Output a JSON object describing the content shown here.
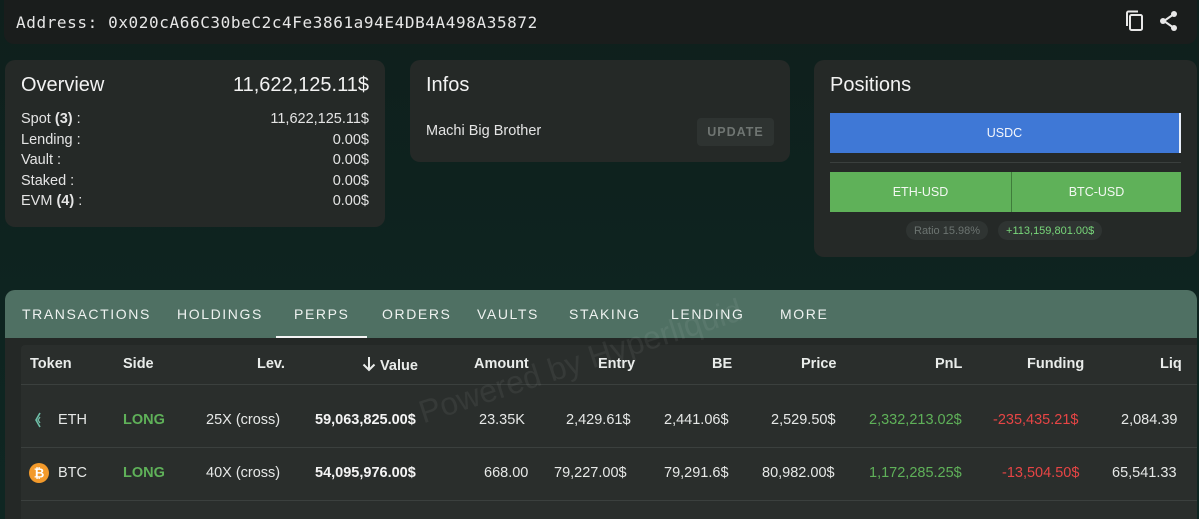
{
  "address": {
    "text": "Address: 0x020cA66C30beC2c4Fe3861a94E4DB4A498A35872",
    "icons": [
      "copy-icon",
      "share-icon"
    ]
  },
  "overview": {
    "title": "Overview",
    "total": "11,622,125.11$",
    "rows": [
      {
        "label": "Spot",
        "count": "(3)",
        "suffix": " :",
        "value": "11,622,125.11$"
      },
      {
        "label": "Lending :",
        "count": "",
        "suffix": "",
        "value": "0.00$"
      },
      {
        "label": "Vault :",
        "count": "",
        "suffix": "",
        "value": "0.00$"
      },
      {
        "label": "Staked :",
        "count": "",
        "suffix": "",
        "value": "0.00$"
      },
      {
        "label": "EVM",
        "count": "(4)",
        "suffix": " :",
        "value": "0.00$"
      }
    ]
  },
  "infos": {
    "title": "Infos",
    "name": "Machi Big Brother",
    "update_label": "UPDATE"
  },
  "positions": {
    "title": "Positions",
    "usdc_label": "USDC",
    "eth_label": "ETH-USD",
    "btc_label": "BTC-USD",
    "ratio": "Ratio 15.98%",
    "pnl": "+113,159,801.00$"
  },
  "tabs": [
    "TRANSACTIONS",
    "HOLDINGS",
    "PERPS",
    "ORDERS",
    "VAULTS",
    "STAKING",
    "LENDING",
    "MORE"
  ],
  "active_tab": "PERPS",
  "table": {
    "headers": {
      "token": "Token",
      "side": "Side",
      "lev": "Lev.",
      "value": "Value",
      "amount": "Amount",
      "entry": "Entry",
      "be": "BE",
      "price": "Price",
      "pnl": "PnL",
      "funding": "Funding",
      "liq": "Liq"
    },
    "rows": [
      {
        "token": "ETH",
        "side": "LONG",
        "lev": "25X (cross)",
        "value": "59,063,825.00$",
        "amount": "23.35K",
        "entry": "2,429.61$",
        "be": "2,441.06$",
        "price": "2,529.50$",
        "pnl": "2,332,213.02$",
        "funding": "-235,435.21$",
        "liq": "2,084.39"
      },
      {
        "token": "BTC",
        "side": "LONG",
        "lev": "40X (cross)",
        "value": "54,095,976.00$",
        "amount": "668.00",
        "entry": "79,227.00$",
        "be": "79,291.6$",
        "price": "80,982.00$",
        "pnl": "1,172,285.25$",
        "funding": "-13,504.50$",
        "liq": "65,541.33"
      }
    ]
  },
  "watermark": "Powered by Hyperliquid",
  "colors": {
    "accent_blue": "#3f78d6",
    "long_green": "#5fb159",
    "negative_red": "#e64545",
    "tab_bar": "#4f7063"
  }
}
